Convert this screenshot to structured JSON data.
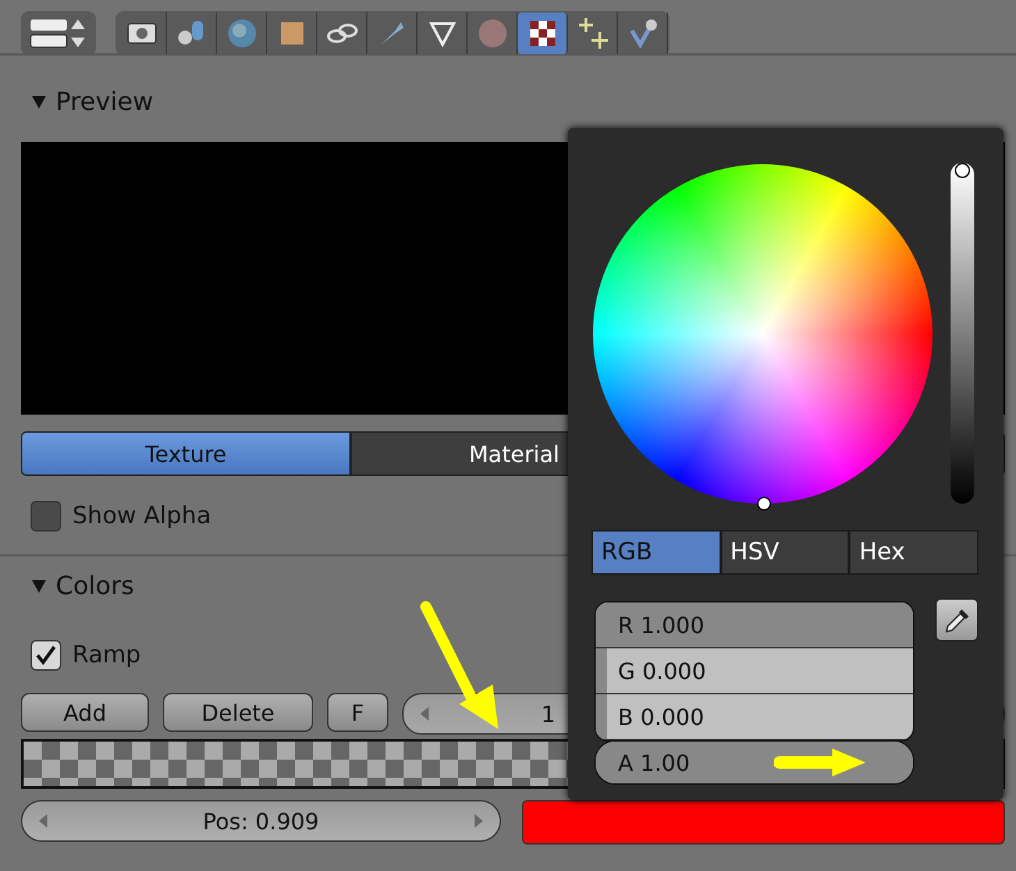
{
  "toolbar": {
    "context_tabs": [
      {
        "selected": false
      },
      {
        "selected": false
      },
      {
        "selected": false
      },
      {
        "selected": false
      },
      {
        "selected": false
      },
      {
        "selected": false
      },
      {
        "selected": false
      },
      {
        "selected": false
      },
      {
        "selected": true
      },
      {
        "selected": false
      },
      {
        "selected": false
      }
    ]
  },
  "preview": {
    "title": "Preview",
    "expanded": true,
    "tabs": [
      {
        "label": "Texture",
        "selected": true
      },
      {
        "label": "Material",
        "selected": false
      }
    ],
    "show_alpha": {
      "label": "Show Alpha",
      "checked": false
    }
  },
  "colors": {
    "title": "Colors",
    "expanded": true,
    "ramp": {
      "label": "Ramp",
      "checked": true
    },
    "buttons": [
      "Add",
      "Delete",
      "F"
    ],
    "index_field": "1",
    "position_field": "Pos: 0.909"
  },
  "color_picker": {
    "value_slider": {
      "level": 1
    },
    "modes": [
      {
        "label": "RGB",
        "selected": true
      },
      {
        "label": "HSV",
        "selected": false
      },
      {
        "label": "Hex",
        "selected": false
      }
    ],
    "channels": [
      {
        "label": "R 1.000",
        "level": 1
      },
      {
        "label": "G 0.000",
        "level": 0
      },
      {
        "label": "B 0.000",
        "level": 0
      }
    ],
    "alpha": {
      "label": "A 1.00",
      "level": 1
    }
  }
}
